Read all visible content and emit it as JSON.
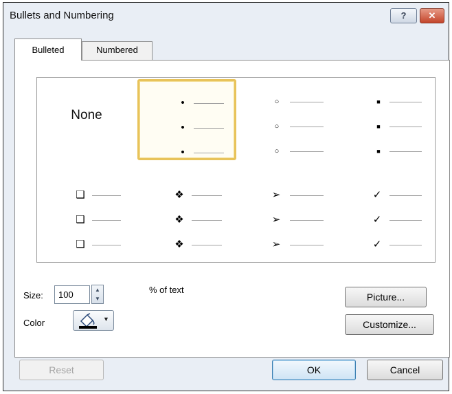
{
  "window": {
    "title": "Bullets and Numbering",
    "help_label": "?",
    "close_label": "✕"
  },
  "tabs": [
    {
      "label": "Bulleted",
      "active": true
    },
    {
      "label": "Numbered",
      "active": false
    }
  ],
  "gallery": {
    "none_label": "None",
    "selected_index": 1,
    "bullet_styles": [
      {
        "name": "none"
      },
      {
        "name": "filled-circle",
        "glyph": "•"
      },
      {
        "name": "hollow-circle",
        "glyph": "○"
      },
      {
        "name": "filled-square",
        "glyph": "■"
      },
      {
        "name": "hollow-square",
        "glyph": "❑"
      },
      {
        "name": "four-diamond",
        "glyph": "❖"
      },
      {
        "name": "arrowhead",
        "glyph": "➢"
      },
      {
        "name": "checkmark",
        "glyph": "✓"
      }
    ]
  },
  "size": {
    "label": "Size:",
    "value": "100",
    "suffix": "% of text"
  },
  "color": {
    "label": "Color",
    "swatch": "#000000",
    "icon": "paint-bucket-icon"
  },
  "buttons": {
    "picture": "Picture...",
    "customize": "Customize...",
    "reset": "Reset",
    "ok": "OK",
    "cancel": "Cancel"
  }
}
